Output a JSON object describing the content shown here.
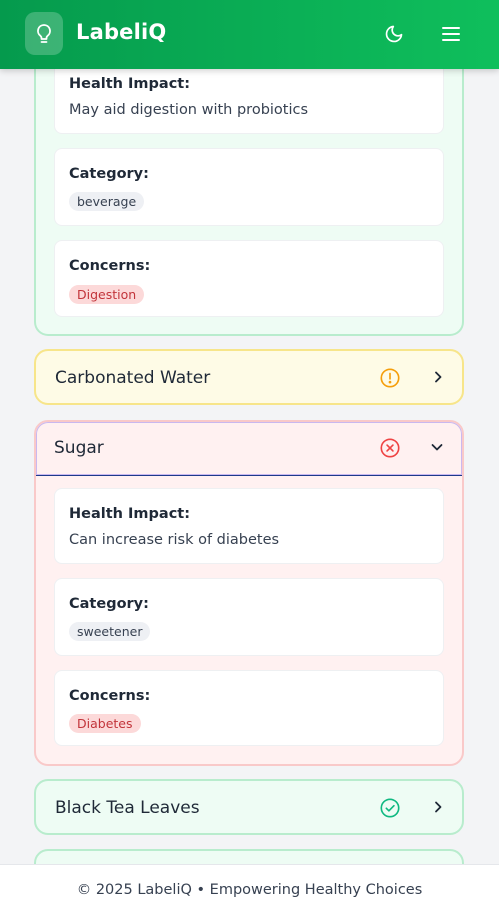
{
  "app": {
    "name": "LabeliQ"
  },
  "header": {
    "theme_icon": "moon-icon",
    "menu_icon": "hamburger-menu-icon",
    "logo_icon": "lightbulb-icon"
  },
  "ingredients": [
    {
      "name": "",
      "status": "good",
      "expanded": true,
      "health_impact_label": "Health Impact:",
      "health_impact": "May aid digestion with probiotics",
      "category_label": "Category:",
      "category": "beverage",
      "concerns_label": "Concerns:",
      "concerns": [
        "Digestion"
      ]
    },
    {
      "name": "Carbonated Water",
      "status": "warning",
      "expanded": false
    },
    {
      "name": "Sugar",
      "status": "bad",
      "expanded": true,
      "health_impact_label": "Health Impact:",
      "health_impact": "Can increase risk of diabetes",
      "category_label": "Category:",
      "category": "sweetener",
      "concerns_label": "Concerns:",
      "concerns": [
        "Diabetes"
      ]
    },
    {
      "name": "Black Tea Leaves",
      "status": "good",
      "expanded": false
    }
  ],
  "colors": {
    "brand": "#059a4d",
    "good": "#10b981",
    "warning": "#f59e0b",
    "bad": "#ef4444"
  },
  "footer": {
    "text": "© 2025 LabeliQ • Empowering Healthy Choices"
  }
}
